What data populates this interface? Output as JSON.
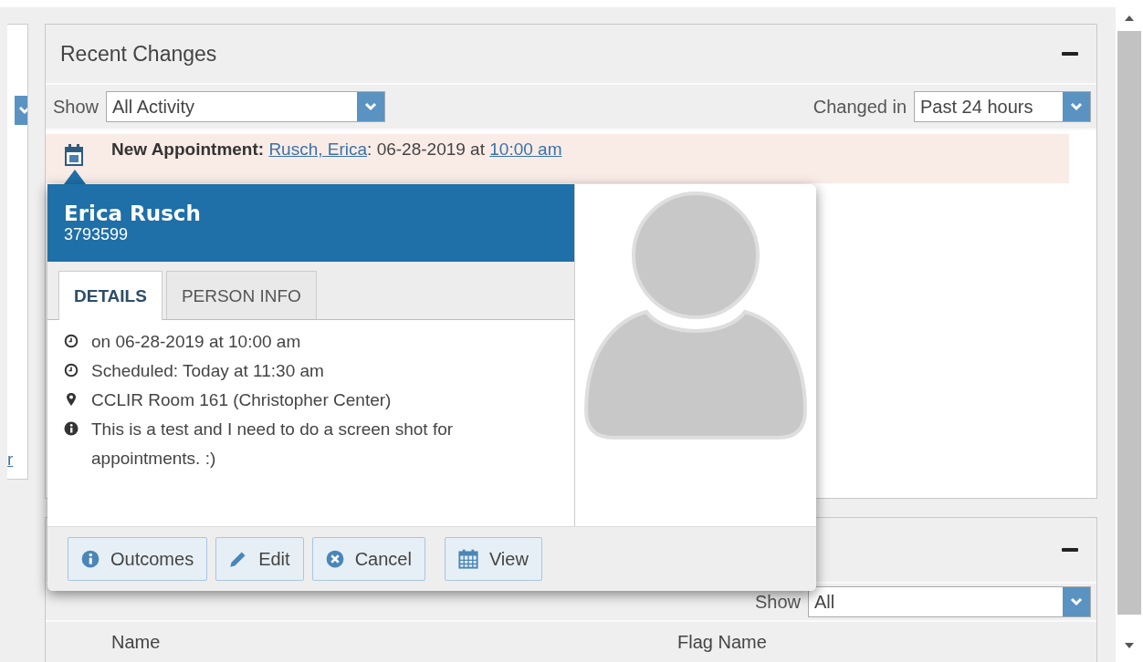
{
  "left_panel": {
    "link": "r"
  },
  "recent_changes": {
    "title": "Recent Changes",
    "show_label": "Show",
    "show_value": "All Activity",
    "changed_label": "Changed in",
    "changed_value": "Past 24 hours",
    "items": [
      {
        "label": "New Appointment:",
        "name": "Rusch, Erica",
        "date": ": 06-28-2019 at",
        "time": "10:00 am",
        "highlighted": true
      }
    ]
  },
  "popover": {
    "name": "Erica Rusch",
    "id": "3793599",
    "tabs": [
      {
        "label": "DETAILS",
        "selected": true
      },
      {
        "label": "PERSON INFO",
        "selected": false
      }
    ],
    "details": [
      {
        "kind": "clock",
        "text": "on 06-28-2019 at 10:00 am"
      },
      {
        "kind": "clock",
        "text": "Scheduled: Today at 11:30 am"
      },
      {
        "kind": "pin",
        "text": "CCLIR Room 161 (Christopher Center)"
      },
      {
        "kind": "info",
        "text": "This is a test and I need to do a screen shot for appointments. :)"
      }
    ],
    "buttons": [
      {
        "kind": "info",
        "label": "Outcomes"
      },
      {
        "kind": "edit",
        "label": "Edit"
      },
      {
        "kind": "cancel",
        "label": "Cancel"
      },
      {
        "kind": "calendar",
        "label": "View"
      }
    ]
  },
  "flags_panel": {
    "show_label": "Show",
    "show_value": "All",
    "columns": [
      "Name",
      "Flag Name"
    ]
  }
}
